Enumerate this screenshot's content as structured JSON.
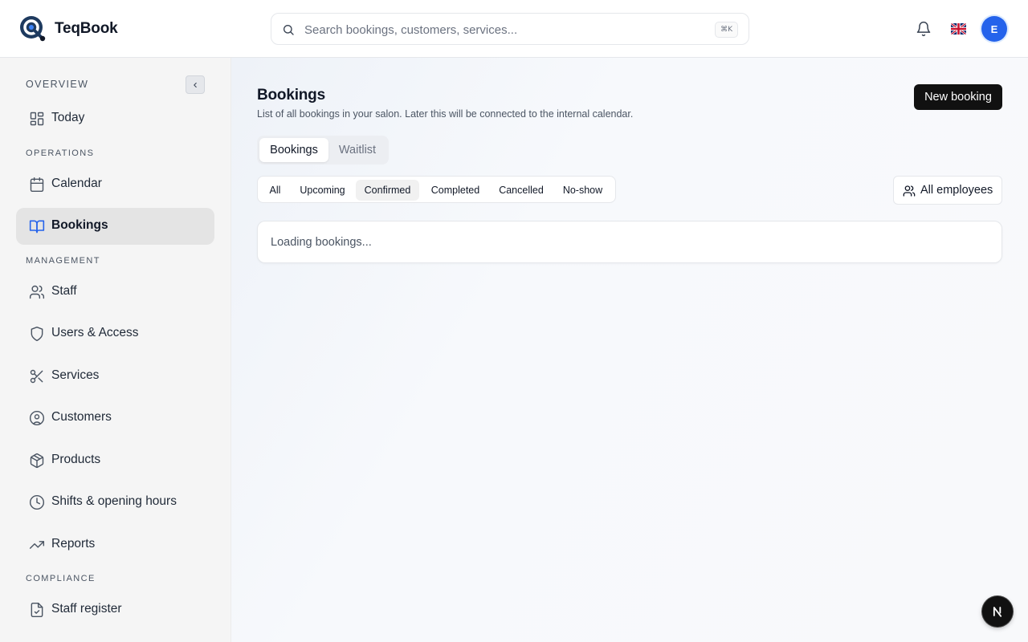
{
  "app": {
    "name": "TeqBook"
  },
  "search": {
    "placeholder": "Search bookings, customers, services...",
    "shortcut": "⌘K"
  },
  "header": {
    "avatar_initial": "E"
  },
  "sidebar": {
    "sections": {
      "overview": "OVERVIEW",
      "operations": "OPERATIONS",
      "management": "MANAGEMENT",
      "compliance": "COMPLIANCE"
    },
    "items": [
      {
        "label": "Today",
        "icon": "dashboard-icon"
      },
      {
        "label": "Calendar",
        "icon": "calendar-icon"
      },
      {
        "label": "Bookings",
        "icon": "book-open-icon",
        "active": true
      },
      {
        "label": "Staff",
        "icon": "users-icon"
      },
      {
        "label": "Users & Access",
        "icon": "shield-icon"
      },
      {
        "label": "Services",
        "icon": "scissors-icon"
      },
      {
        "label": "Customers",
        "icon": "user-circle-icon"
      },
      {
        "label": "Products",
        "icon": "package-icon"
      },
      {
        "label": "Shifts & opening hours",
        "icon": "clock-icon"
      },
      {
        "label": "Reports",
        "icon": "trending-up-icon"
      },
      {
        "label": "Staff register",
        "icon": "file-check-icon"
      }
    ]
  },
  "main": {
    "title": "Bookings",
    "subtitle": "List of all bookings in your salon. Later this will be connected to the internal calendar.",
    "new_button": "New booking",
    "tabs": [
      "Bookings",
      "Waitlist"
    ],
    "filters": [
      "All",
      "Upcoming",
      "Confirmed",
      "Completed",
      "Cancelled",
      "No-show"
    ],
    "selected_filter": "Confirmed",
    "employee_filter": "All employees",
    "loading": "Loading bookings..."
  },
  "colors": {
    "accent": "#2563eb",
    "primary_button": "#111111",
    "active_nav": "#e4e4e4"
  }
}
